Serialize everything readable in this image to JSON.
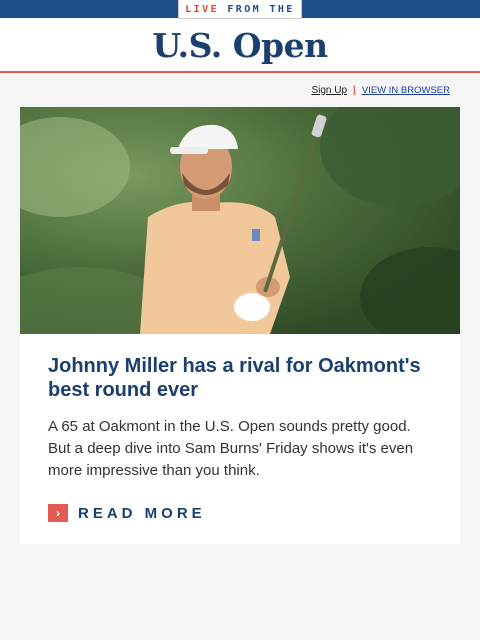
{
  "banner": {
    "live_prefix": "LIVE",
    "live_suffix": " FROM THE"
  },
  "logo": {
    "text": "U.S. Open"
  },
  "utility": {
    "signup_label": "Sign Up",
    "divider": "|",
    "browser_label": "VIEW IN BROWSER"
  },
  "article": {
    "image_icon": "golfer-photo-icon",
    "headline": "Johnny Miller has a rival for Oakmont's best round ever",
    "summary": "A 65 at Oakmont in the U.S. Open sounds pretty good. But a deep dive into Sam Burns' Friday shows it's even more impressive than you think.",
    "cta_label": "READ MORE",
    "cta_icon": "chevron-right-icon"
  },
  "colors": {
    "navy": "#1b3f6e",
    "banner_blue": "#1e4f88",
    "accent_red": "#e35a52",
    "background": "#f5f5f5"
  }
}
